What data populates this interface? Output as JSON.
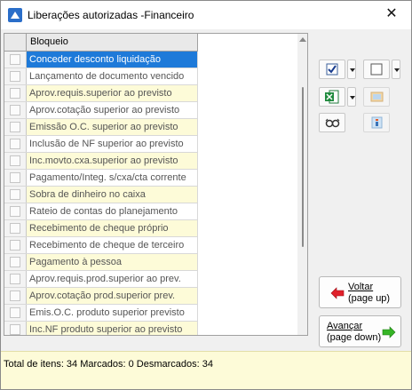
{
  "window": {
    "title": "Liberações autorizadas -Financeiro",
    "close_glyph": "✕"
  },
  "grid": {
    "column_header": "Bloqueio",
    "rows": [
      {
        "label": "Conceder desconto liquidação",
        "style": "selected"
      },
      {
        "label": "Lançamento de documento vencido",
        "style": "white"
      },
      {
        "label": "Aprov.requis.superior ao previsto",
        "style": "yellow"
      },
      {
        "label": "Aprov.cotação superior ao previsto",
        "style": "white"
      },
      {
        "label": "Emissão O.C. superior ao previsto",
        "style": "yellow"
      },
      {
        "label": "Inclusão de NF superior ao previsto",
        "style": "white"
      },
      {
        "label": "Inc.movto.cxa.superior ao previsto",
        "style": "yellow"
      },
      {
        "label": "Pagamento/Integ. s/cxa/cta corrente",
        "style": "white"
      },
      {
        "label": "Sobra de dinheiro no caixa",
        "style": "yellow"
      },
      {
        "label": "Rateio de contas do planejamento",
        "style": "white"
      },
      {
        "label": "Recebimento de cheque próprio",
        "style": "yellow"
      },
      {
        "label": "Recebimento de cheque de terceiro",
        "style": "white"
      },
      {
        "label": "Pagamento à pessoa",
        "style": "yellow"
      },
      {
        "label": "Aprov.requis.prod.superior ao prev.",
        "style": "white"
      },
      {
        "label": "Aprov.cotação prod.superior prev.",
        "style": "yellow"
      },
      {
        "label": "Emis.O.C. produto superior previsto",
        "style": "white"
      },
      {
        "label": "Inc.NF produto superior ao previsto",
        "style": "yellow"
      }
    ]
  },
  "toolbar": {
    "check_all_icon": "checkbox-checked-icon",
    "uncheck_all_icon": "checkbox-empty-icon",
    "excel_icon": "excel-export-icon",
    "folder_icon": "folder-image-icon",
    "glasses_icon": "glasses-icon",
    "info_icon": "info-icon"
  },
  "nav": {
    "back_label_1": "Voltar",
    "back_label_2": "(page up)",
    "next_label_1": "Avançar",
    "next_label_2": "(page down)"
  },
  "status": {
    "text": "Total de itens: 34 Marcados: 0 Desmarcados: 34"
  },
  "colors": {
    "selected_row": "#1e7ad9",
    "alt_row": "#fdfbd8",
    "status_bg": "#fdfbd8",
    "back_arrow": "#e0202a",
    "next_arrow": "#36b526"
  }
}
